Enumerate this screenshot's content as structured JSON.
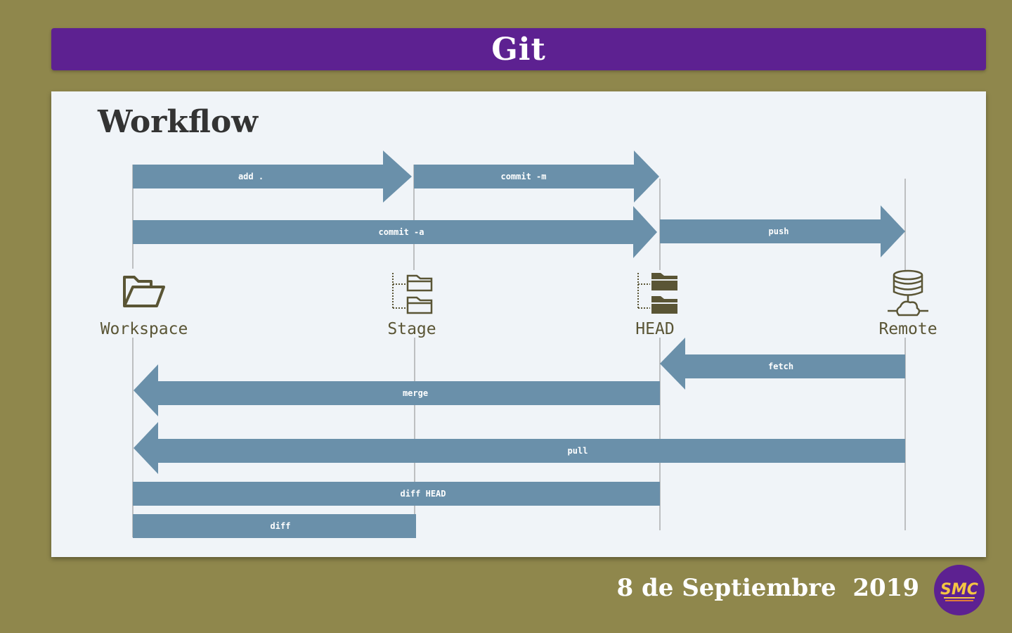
{
  "header": {
    "title": "Git"
  },
  "panel": {
    "heading": "Workflow"
  },
  "nodes": [
    {
      "label": "Workspace",
      "icon": "open-folder-icon"
    },
    {
      "label": "Stage",
      "icon": "staged-folders-icon"
    },
    {
      "label": "HEAD",
      "icon": "committed-folders-icon"
    },
    {
      "label": "Remote",
      "icon": "server-cloud-icon"
    }
  ],
  "commands": {
    "add": "add .",
    "commit_m": "commit -m",
    "commit_a": "commit -a",
    "push": "push",
    "fetch": "fetch",
    "merge": "merge",
    "pull": "pull",
    "diff_head": "diff HEAD",
    "diff": "diff"
  },
  "footer": {
    "date": "8 de Septiembre  2019",
    "logo_text": "SMC"
  },
  "colors": {
    "background": "#8f874c",
    "title_bar": "#5d2191",
    "arrow": "#6a90aa",
    "icon": "#5a5535",
    "panel": "#f0f4f8"
  }
}
